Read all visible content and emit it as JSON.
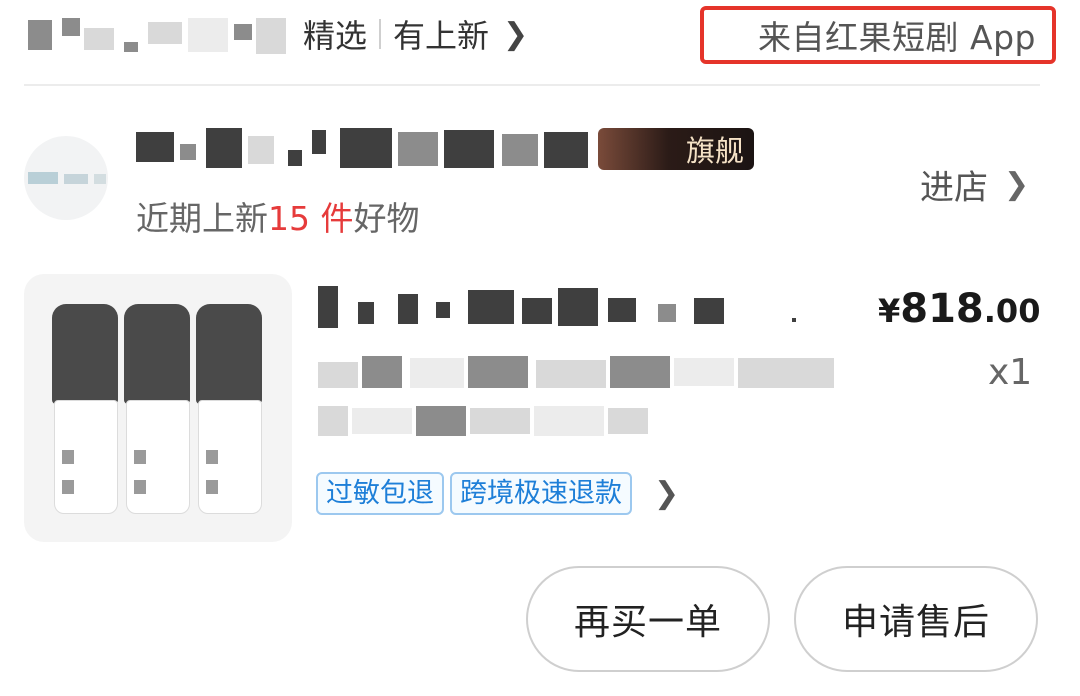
{
  "header": {
    "store_source_tail": "精选",
    "new_arrivals_link": "有上新",
    "source_app": "来自红果短剧 App"
  },
  "store": {
    "badge": "旗舰",
    "subtitle_prefix": "近期上新",
    "new_count": "15 件",
    "subtitle_suffix": "好物",
    "enter_label": "进店"
  },
  "product": {
    "price_symbol": "¥",
    "price_main": "818",
    "price_decimal": ".00",
    "quantity": "x1",
    "tags": [
      "过敏包退",
      "跨境极速退款"
    ]
  },
  "actions": {
    "rebuy": "再买一单",
    "after_sale": "申请售后"
  },
  "colors": {
    "highlight_border": "#e5342a",
    "new_count": "#e63b3b",
    "tag_text": "#1e7fd8"
  }
}
